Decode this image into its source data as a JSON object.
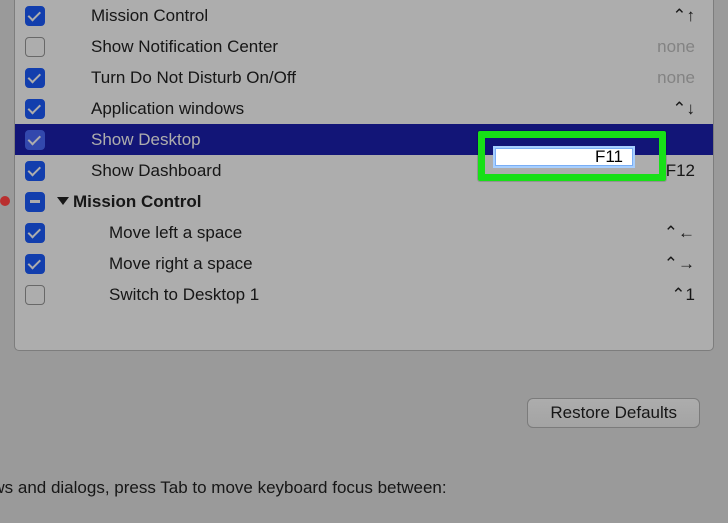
{
  "rows": [
    {
      "label": "Mission Control",
      "checked": true,
      "shortcut": "⌃↑",
      "shortcut_class": ""
    },
    {
      "label": "Show Notification Center",
      "checked": false,
      "shortcut": "none",
      "shortcut_class": "none"
    },
    {
      "label": "Turn Do Not Disturb On/Off",
      "checked": true,
      "shortcut": "none",
      "shortcut_class": "none"
    },
    {
      "label": "Application windows",
      "checked": true,
      "shortcut": "⌃↓",
      "shortcut_class": ""
    },
    {
      "label": "Show Desktop",
      "checked": true,
      "shortcut": "",
      "shortcut_class": "",
      "selected": true
    },
    {
      "label": "Show Dashboard",
      "checked": true,
      "shortcut": "F12",
      "shortcut_class": ""
    }
  ],
  "group": {
    "label": "Mission Control"
  },
  "children": [
    {
      "label": "Move left a space",
      "checked": true,
      "shortcut": "⌃←"
    },
    {
      "label": "Move right a space",
      "checked": true,
      "shortcut": "⌃→"
    },
    {
      "label": "Switch to Desktop 1",
      "checked": false,
      "shortcut": "⌃1"
    }
  ],
  "shortcut_editor_value": "F11",
  "restore_defaults": "Restore Defaults",
  "bottom_text": "ndows and dialogs, press Tab to move keyboard focus between:"
}
